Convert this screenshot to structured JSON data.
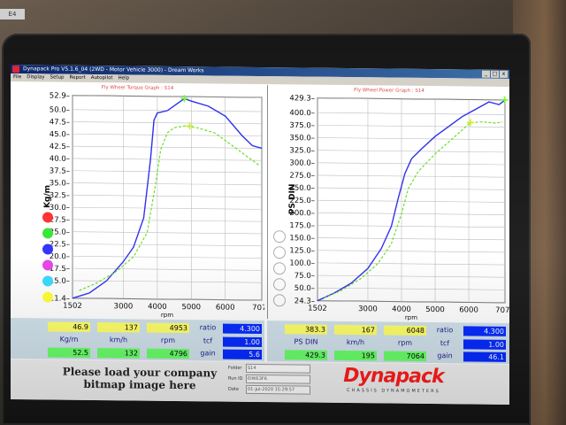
{
  "window": {
    "title": "Dynapack Pro V5.1.6_04 (2WD - Motor Vehicle 3000) - Dream Works",
    "min": "_",
    "max": "□",
    "close": "x"
  },
  "menu": [
    "File",
    "Display",
    "Setup",
    "Report",
    "Autopilot",
    "Help"
  ],
  "sticker": "E4",
  "torque_graph": {
    "title": "Fly Wheel Torque Graph : S14",
    "ylabel": "Kg/m",
    "xlabel": "rpm",
    "yticks": [
      "52.9",
      "50.0",
      "47.5",
      "45.0",
      "42.5",
      "40.0",
      "37.5",
      "35.0",
      "32.5",
      "30.0",
      "27.5",
      "25.0",
      "22.5",
      "20.0",
      "17.5",
      "15.0",
      "11.4"
    ],
    "xticks": [
      "1502",
      "3000",
      "4000",
      "5000",
      "6000",
      "7076"
    ]
  },
  "power_graph": {
    "title": "Fly Wheel Power Graph : S14",
    "ylabel": "PS DIN",
    "xlabel": "rpm",
    "yticks": [
      "429.3",
      "400.0",
      "375.0",
      "350.0",
      "325.0",
      "300.0",
      "275.0",
      "250.0",
      "225.0",
      "200.0",
      "175.0",
      "150.0",
      "125.0",
      "100.0",
      "75.0",
      "50.0",
      "24.3"
    ],
    "xticks": [
      "1502",
      "3000",
      "4000",
      "5000",
      "6000",
      "7076"
    ]
  },
  "legend_colors": [
    "#ff2a2a",
    "#2ee62e",
    "#2a2aff",
    "#e63ee6",
    "#33d9ff",
    "#ffff33"
  ],
  "chart_data": [
    {
      "type": "line",
      "title": "Fly Wheel Torque Graph : S14",
      "xlabel": "rpm",
      "ylabel": "Kg/m",
      "xlim": [
        1502,
        7076
      ],
      "ylim": [
        11.4,
        52.9
      ],
      "grid": true,
      "series": [
        {
          "color": "#2a2aee",
          "x": [
            1502,
            2000,
            2500,
            3000,
            3300,
            3600,
            3800,
            3900,
            4000,
            4300,
            4600,
            4800,
            5000,
            5500,
            6000,
            6500,
            6800,
            7076
          ],
          "y": [
            11.4,
            12.5,
            15,
            19,
            22,
            28,
            40,
            48,
            49.5,
            50,
            51.5,
            52.5,
            52,
            51,
            49,
            45,
            43,
            42.5
          ]
        },
        {
          "color": "#66dd22",
          "x": [
            1700,
            2200,
            2800,
            3300,
            3700,
            3950,
            4100,
            4300,
            4500,
            4800,
            5200,
            5700,
            6200,
            6600,
            7000
          ],
          "y": [
            13,
            14.5,
            17,
            20,
            25,
            35,
            42,
            45.5,
            46.5,
            46.9,
            46.5,
            45.5,
            43,
            41,
            39
          ]
        }
      ],
      "markers": [
        {
          "x": 4796,
          "y": 52.5,
          "color": "#66ff22"
        },
        {
          "x": 4953,
          "y": 46.9,
          "color": "#ccee22"
        }
      ]
    },
    {
      "type": "line",
      "title": "Fly Wheel Power Graph : S14",
      "xlabel": "rpm",
      "ylabel": "PS DIN",
      "xlim": [
        1502,
        7076
      ],
      "ylim": [
        24.3,
        429.3
      ],
      "grid": true,
      "series": [
        {
          "color": "#2a2aee",
          "x": [
            1502,
            2000,
            2500,
            3000,
            3400,
            3700,
            3900,
            4100,
            4300,
            4600,
            5000,
            5400,
            5800,
            6200,
            6600,
            6900,
            7076
          ],
          "y": [
            24.3,
            40,
            60,
            90,
            130,
            175,
            230,
            280,
            310,
            330,
            355,
            375,
            395,
            410,
            425,
            420,
            429.3
          ]
        },
        {
          "color": "#66dd22",
          "x": [
            1700,
            2200,
            2800,
            3300,
            3700,
            4000,
            4200,
            4500,
            5000,
            5500,
            6048,
            6400,
            6800,
            7000
          ],
          "y": [
            30,
            45,
            70,
            100,
            140,
            200,
            250,
            285,
            320,
            350,
            383.3,
            385,
            383,
            385
          ]
        }
      ],
      "markers": [
        {
          "x": 7064,
          "y": 429.3,
          "color": "#66ff22"
        },
        {
          "x": 6048,
          "y": 383.3,
          "color": "#ccee22"
        }
      ]
    }
  ],
  "readout_left": {
    "yellow": [
      "46.9",
      "137",
      "4953"
    ],
    "labels": [
      "Kg/m",
      "km/h",
      "rpm"
    ],
    "green": [
      "52.5",
      "132",
      "4796"
    ],
    "ratio_label": "ratio",
    "ratio": "4.300",
    "tcf_label": "tcf",
    "tcf": "1.00",
    "gain_label": "gain",
    "gain": "5.6"
  },
  "readout_right": {
    "yellow": [
      "383.3",
      "167",
      "6048"
    ],
    "labels": [
      "PS DIN",
      "km/h",
      "rpm"
    ],
    "green": [
      "429.3",
      "195",
      "7064"
    ],
    "ratio_label": "ratio",
    "ratio": "4.300",
    "tcf_label": "tcf",
    "tcf": "1.00",
    "gain_label": "gain",
    "gain": "46.1"
  },
  "footer": {
    "bitmap_line1": "Please load your company",
    "bitmap_line2": "bitmap image here",
    "info_labels": [
      "Folder",
      "Run ID",
      "Date"
    ],
    "info_values": [
      "S14",
      "EIWE3F6",
      "01-Jul-2020  15:29:57"
    ],
    "logo": "Dynapack",
    "logo_sub": "CHASSIS DYNAMOMETERS"
  }
}
